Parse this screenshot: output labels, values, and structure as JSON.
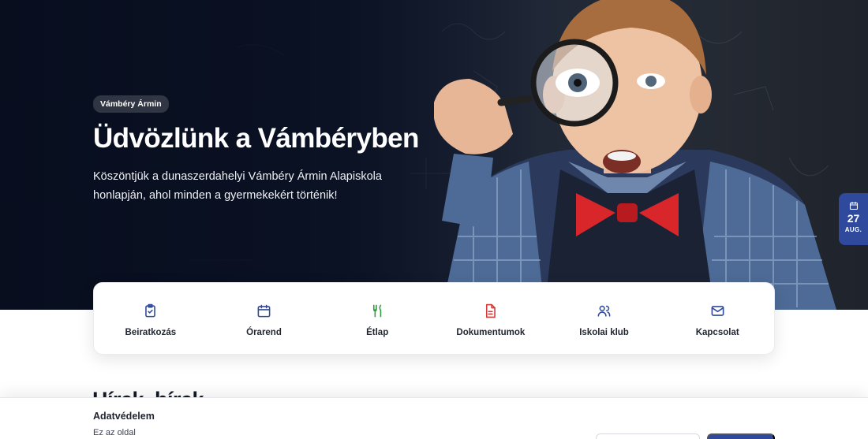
{
  "hero": {
    "badge": "Vámbéry Ármin",
    "title": "Üdvözlünk a Vámbéryben",
    "subtitle_line1": "Köszöntjük a dunaszerdahelyi Vámbéry Ármin Alapiskola",
    "subtitle_line2": "honlapján, ahol minden a gyermekekért történik!"
  },
  "date_tab": {
    "icon": "calendar-icon",
    "day": "27",
    "month": "AUG."
  },
  "quick_links": [
    {
      "label": "Beiratkozás",
      "icon": "clipboard-check-icon",
      "color": "#2f4a9c"
    },
    {
      "label": "Órarend",
      "icon": "calendar-icon",
      "color": "#2f4a9c"
    },
    {
      "label": "Étlap",
      "icon": "fork-knife-icon",
      "color": "#2f9a3e"
    },
    {
      "label": "Dokumentumok",
      "icon": "document-icon",
      "color": "#d23a3a"
    },
    {
      "label": "Iskolai klub",
      "icon": "users-icon",
      "color": "#2f4a9c"
    },
    {
      "label": "Kapcsolat",
      "icon": "mail-icon",
      "color": "#2f4a9c"
    }
  ],
  "section": {
    "heading": "Hírek, hírek"
  },
  "cookie": {
    "title": "Adatvédelem",
    "text": "Ez az oldal"
  },
  "colors": {
    "primary": "#2f4a9c",
    "hero_dark": "#0b1326"
  }
}
